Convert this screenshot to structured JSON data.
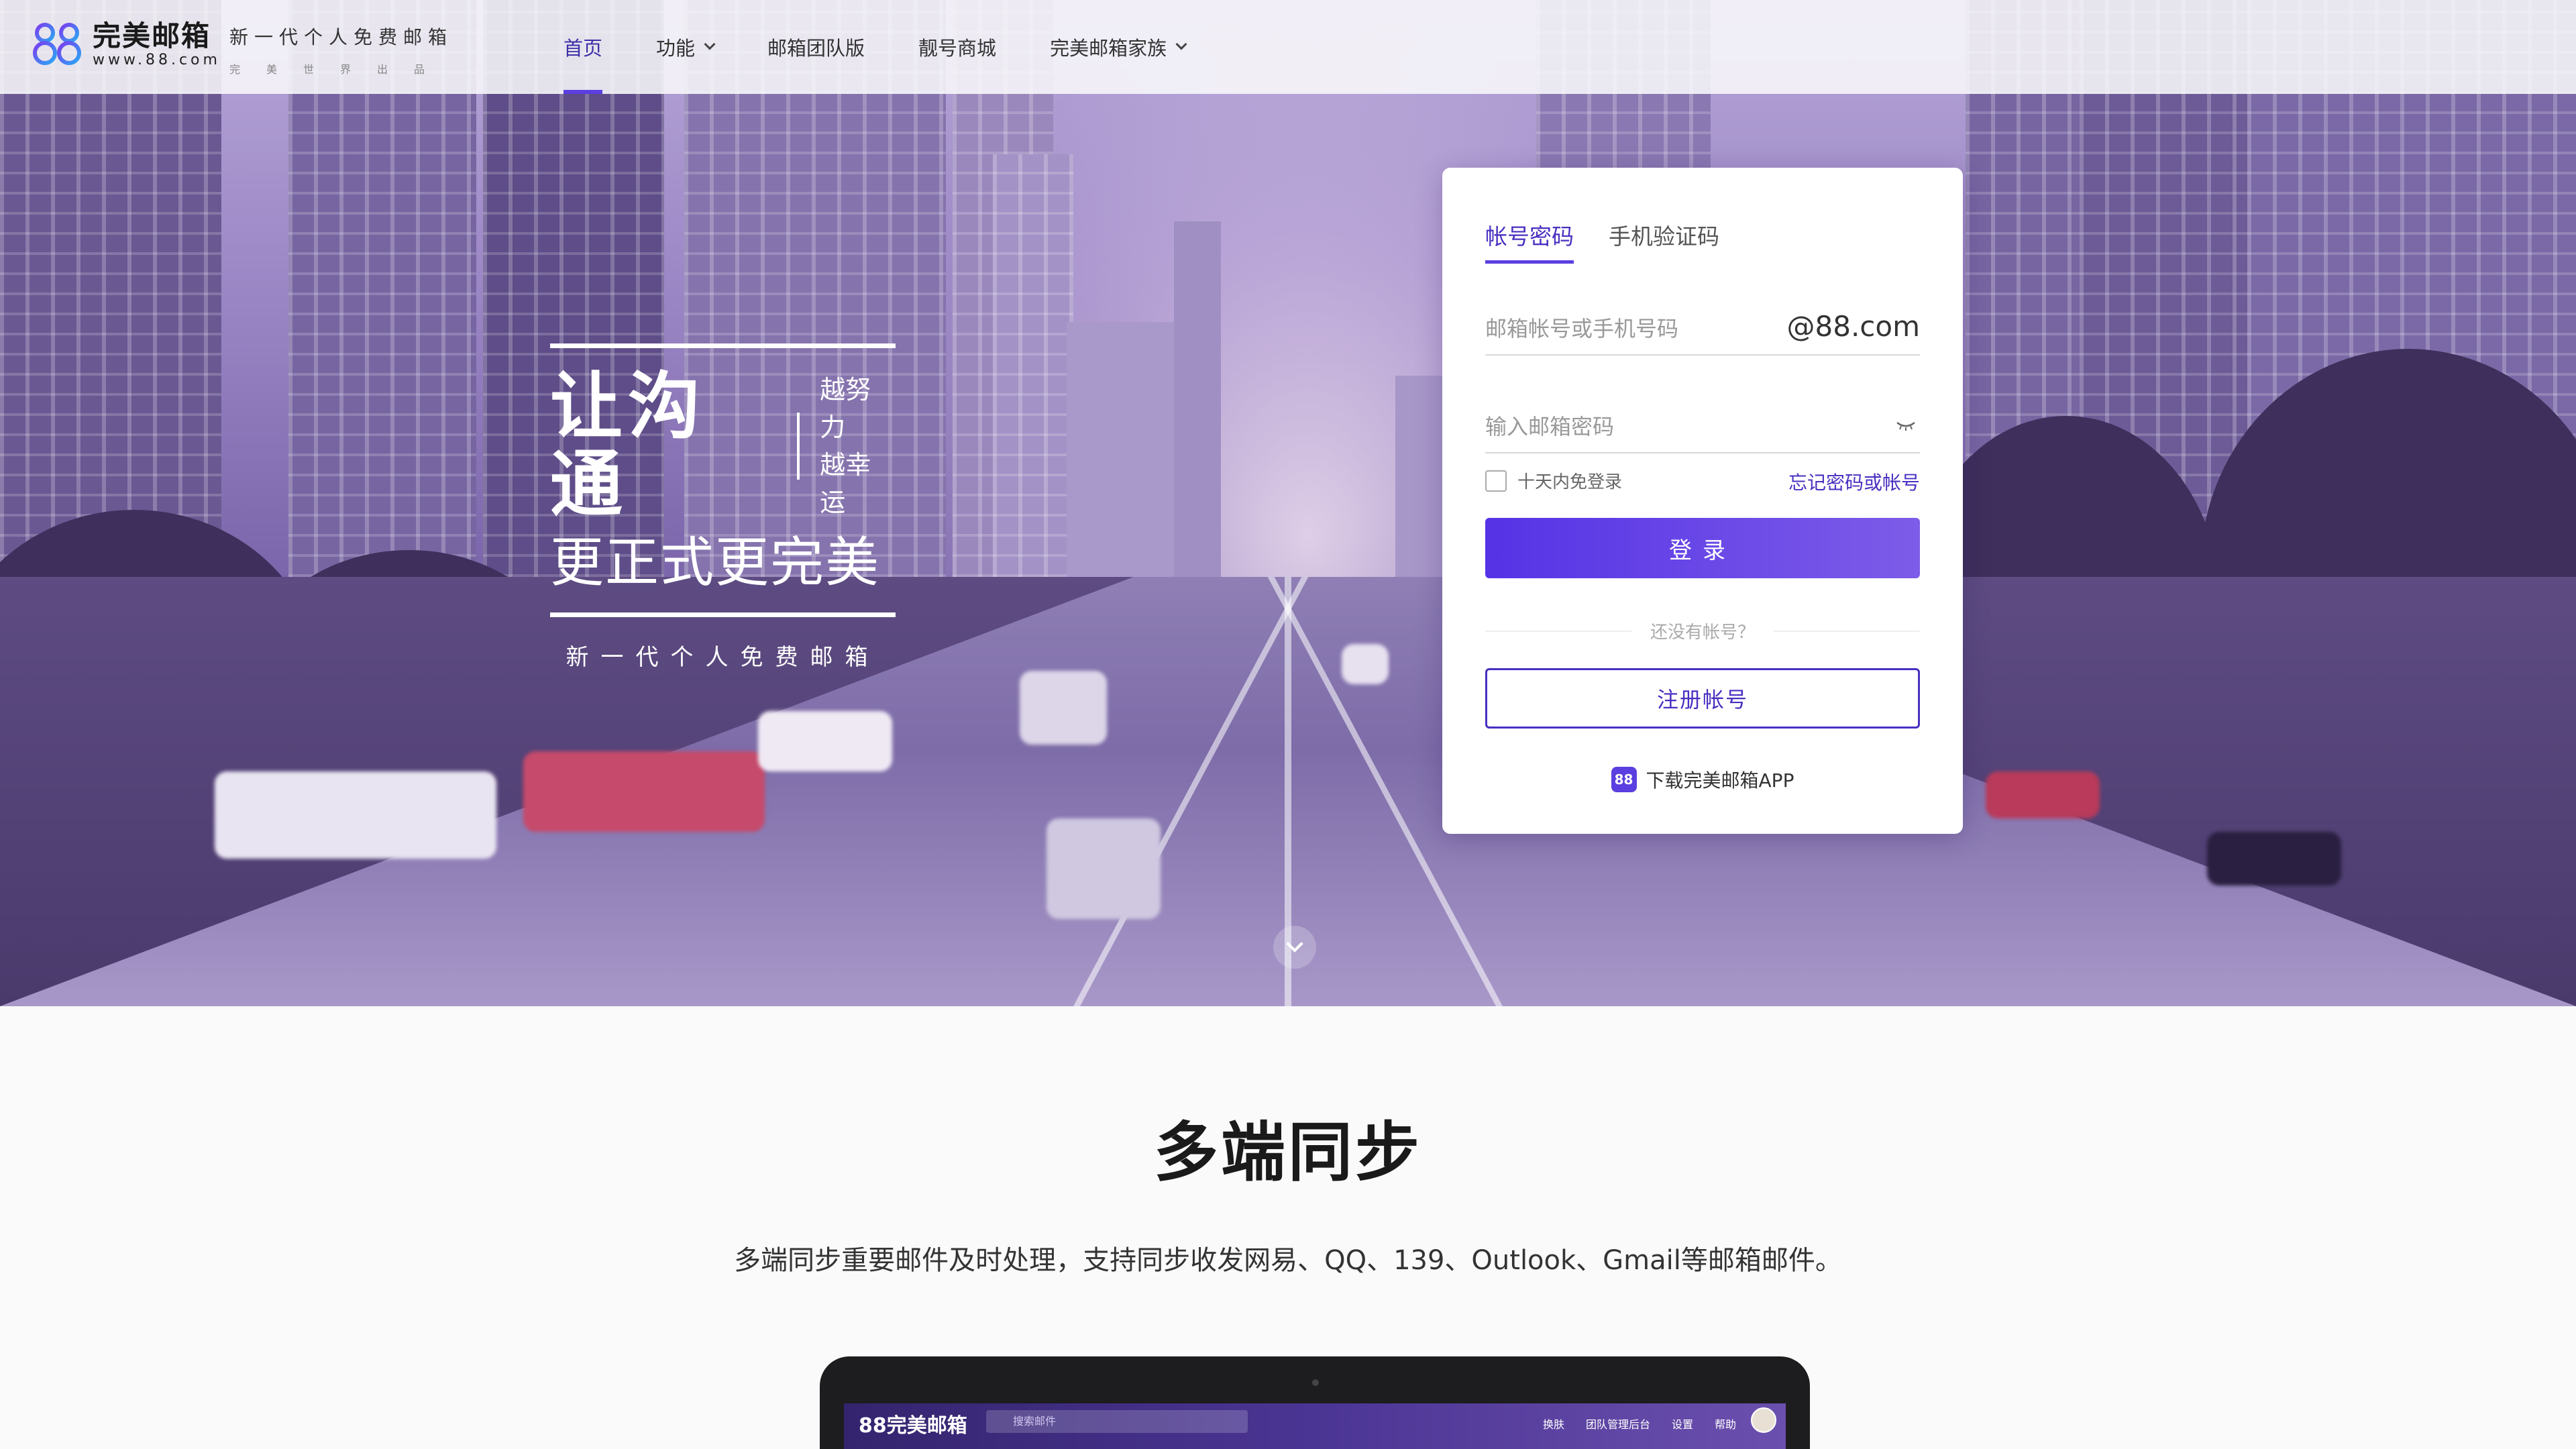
{
  "brand": {
    "logo_mark": "88",
    "name": "完美邮箱",
    "url": "www.88.com",
    "slogan": "新一代个人免费邮箱",
    "slogan_sub": "完美世界出品",
    "accent_color": "#5b3fe0"
  },
  "nav": {
    "items": [
      {
        "label": "首页",
        "active": true
      },
      {
        "label": "功能",
        "has_dropdown": true
      },
      {
        "label": "邮箱团队版"
      },
      {
        "label": "靓号商城"
      },
      {
        "label": "完美邮箱家族",
        "has_dropdown": true
      }
    ]
  },
  "hero": {
    "headline": "让沟通",
    "side_line_1": "越努力",
    "side_line_2": "越幸运",
    "subline": "更正式更完美",
    "tagline": "新一代个人免费邮箱"
  },
  "login": {
    "tabs": [
      {
        "label": "帐号密码",
        "active": true
      },
      {
        "label": "手机验证码",
        "active": false
      }
    ],
    "account_placeholder": "邮箱帐号或手机号码",
    "account_suffix": "@88.com",
    "password_placeholder": "输入邮箱密码",
    "remember_label": "十天内免登录",
    "forgot_label": "忘记密码或帐号",
    "login_button": "登录",
    "no_account_text": "还没有帐号？",
    "register_button": "注册帐号",
    "download_icon_text": "88",
    "download_label": "下载完美邮箱APP"
  },
  "section": {
    "title": "多端同步",
    "description": "多端同步重要邮件及时处理，支持同步收发网易、QQ、139、Outlook、Gmail等邮箱邮件。"
  },
  "laptop_screen": {
    "logo": "88完美邮箱",
    "search_placeholder": "搜索邮件",
    "menu": [
      "换肤",
      "团队管理后台",
      "设置",
      "帮助"
    ]
  },
  "icons": {
    "scroll": "chevron-down-icon",
    "password_toggle": "eye-closed-icon",
    "nav_dropdown": "chevron-down-icon"
  }
}
